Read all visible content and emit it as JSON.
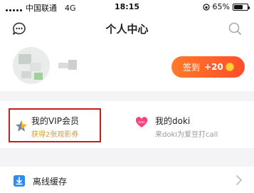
{
  "status_bar": {
    "carrier": "中国联通",
    "network": "4G",
    "time": "18:15",
    "battery": "65%",
    "battery_level": 0.65
  },
  "nav": {
    "title": "个人中心",
    "left_icon": "message-icon",
    "right_icon": "search-icon"
  },
  "profile": {
    "checkin_label": "签到",
    "checkin_points": "+20",
    "accent": "#ff5a2a"
  },
  "cards": {
    "vip": {
      "title": "我的VIP会员",
      "subtitle": "获得2张观影券",
      "highlight_color": "#c21f1f"
    },
    "doki": {
      "title": "我的doki",
      "subtitle": "来doki为爱豆打call"
    }
  },
  "list": [
    {
      "label": "离线缓存",
      "icon": "download-icon"
    }
  ]
}
